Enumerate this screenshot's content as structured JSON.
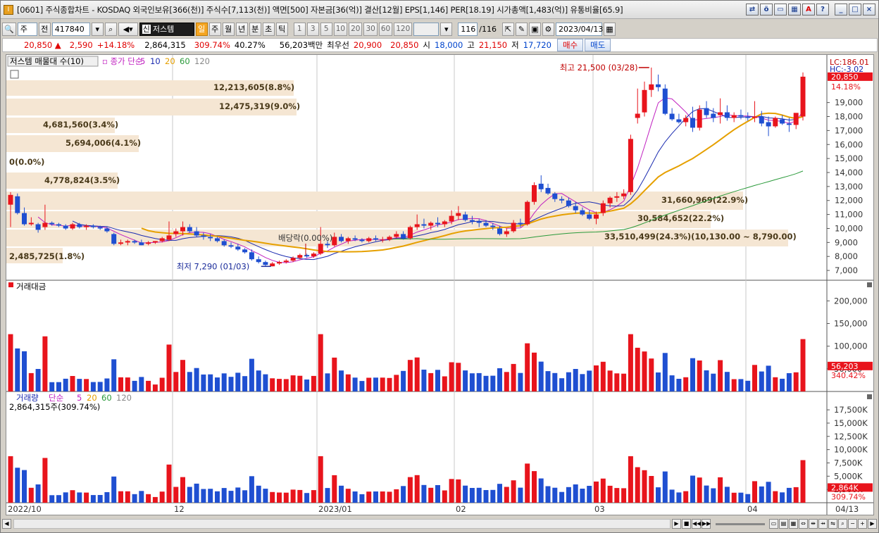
{
  "window": {
    "title": "[0601] 주식종합차트 - KOSDAQ 외국인보유[366(천)] 주식수[7,113(천)] 액면[500] 자본금[36(억)] 결산[12월] EPS[1,146] PER[18.19] 시가총액[1,483(억)] 유통비율[65.9]",
    "icon_label": "I"
  },
  "toolbar": {
    "market": "주",
    "prev_label": "전",
    "code": "417840",
    "stock_name": "저스템",
    "stock_badge": "신",
    "periods": [
      "일",
      "주",
      "월",
      "년",
      "분",
      "초",
      "틱"
    ],
    "active_period": "일",
    "intervals": [
      "1",
      "3",
      "5",
      "10",
      "20",
      "30",
      "60",
      "120"
    ],
    "count": "116",
    "count_total": "/116",
    "date": "2023/04/13"
  },
  "quote": {
    "price": "20,850",
    "arrow": "▲",
    "change": "2,590",
    "change_pct": "+14.18%",
    "volume": "2,864,315",
    "volume_ratio": "309.74%",
    "turnover_ratio": "40.27%",
    "amount": "56,203백만",
    "best_label": "최우선",
    "best_ask": "20,900",
    "best_bid": "20,850",
    "open_label": "시",
    "open": "18,000",
    "high_label": "고",
    "high": "21,150",
    "low_label": "저",
    "low": "17,720",
    "buy_label": "매수",
    "sell_label": "매도"
  },
  "price_panel": {
    "legend_name": "저스템 매물대 수(10)",
    "legend_ma": "종가 단순",
    "ma_periods": [
      "5",
      "10",
      "20",
      "60",
      "120"
    ],
    "ma_colors": {
      "5": "#c020c0",
      "10": "#1a2bb0",
      "20": "#e6a000",
      "60": "#2a9a3a",
      "120": "#888888"
    },
    "lc": "LC:186.01",
    "hc": "HC:-3.02",
    "current_price_tag": "20,850",
    "current_pct_tag": "14.18%",
    "high_note": "최고 21,500 (03/28)",
    "low_note": "최저 7,290 (01/03)",
    "dividend_note": "배당락(0.00%)",
    "volume_profile": [
      {
        "label": "12,213,605(8.8%)"
      },
      {
        "label": "12,475,319(9.0%)"
      },
      {
        "label": "4,681,560(3.4%)"
      },
      {
        "label": "5,694,006(4.1%)"
      },
      {
        "label": "0(0.0%)"
      },
      {
        "label": "4,778,824(3.5%)"
      },
      {
        "label": "31,660,969(22.9%)"
      },
      {
        "label": "30,584,652(22.2%)"
      },
      {
        "label": "33,510,499(24.3%)(10,130.00 ~ 8,790.00)"
      },
      {
        "label": "2,485,725(1.8%)"
      }
    ],
    "y_ticks": [
      "19,000",
      "18,000",
      "17,000",
      "16,000",
      "15,000",
      "14,000",
      "13,000",
      "12,000",
      "11,000",
      "10,000",
      "9,000",
      "8,000",
      "7,000"
    ]
  },
  "amount_panel": {
    "title": "거래대금",
    "y_ticks": [
      "200,000",
      "150,000",
      "100,000",
      "50,000"
    ],
    "tag_value": "56,203",
    "tag_pct": "340.42%"
  },
  "volume_panel": {
    "title": "거래량",
    "legend_ma": "단순",
    "ma_periods": [
      "5",
      "20",
      "60",
      "120"
    ],
    "current_label": "2,864,315주(309.74%)",
    "y_ticks": [
      "17,500K",
      "15,000K",
      "12,500K",
      "10,000K",
      "7,500K",
      "5,000K",
      "2,500K"
    ],
    "tag_value": "2,864K",
    "tag_pct": "309.74%"
  },
  "x_axis": {
    "labels": [
      "2022/10",
      "12",
      "2023/01",
      "02",
      "03",
      "04"
    ],
    "last_label": "04/13"
  },
  "chart_data": {
    "type": "candlestick",
    "ohlc": [
      [
        11700,
        12600,
        10100,
        12400
      ],
      [
        12300,
        12500,
        11000,
        11100
      ],
      [
        11100,
        11500,
        10200,
        10300
      ],
      [
        10300,
        10800,
        10200,
        10400
      ],
      [
        10300,
        10400,
        9700,
        9900
      ],
      [
        10100,
        11700,
        9900,
        10400
      ],
      [
        10400,
        10500,
        10200,
        10300
      ],
      [
        10300,
        10400,
        10100,
        10200
      ],
      [
        10200,
        10300,
        9900,
        10000
      ],
      [
        10000,
        10400,
        9900,
        10300
      ],
      [
        10300,
        10400,
        10000,
        10100
      ],
      [
        10100,
        10300,
        9900,
        10200
      ],
      [
        10200,
        10300,
        10000,
        10100
      ],
      [
        10100,
        10200,
        9900,
        10000
      ],
      [
        10000,
        10100,
        9700,
        9800
      ],
      [
        9600,
        9700,
        8800,
        8900
      ],
      [
        8900,
        9200,
        8800,
        9000
      ],
      [
        9000,
        9200,
        8800,
        9100
      ],
      [
        9100,
        9200,
        8900,
        9000
      ],
      [
        9000,
        9200,
        8800,
        8800
      ],
      [
        8900,
        9100,
        8800,
        9000
      ],
      [
        9000,
        9100,
        8900,
        9100
      ],
      [
        9100,
        9400,
        9000,
        9300
      ],
      [
        9200,
        10500,
        9100,
        9500
      ],
      [
        9600,
        10000,
        9400,
        9800
      ],
      [
        9800,
        10500,
        9500,
        10100
      ],
      [
        10100,
        10300,
        9700,
        9800
      ],
      [
        9800,
        10100,
        9400,
        9500
      ],
      [
        9500,
        9700,
        9200,
        9400
      ],
      [
        9400,
        9600,
        9100,
        9300
      ],
      [
        9300,
        9400,
        9000,
        9100
      ],
      [
        9100,
        9200,
        8700,
        8800
      ],
      [
        8800,
        9000,
        8600,
        8700
      ],
      [
        8700,
        8900,
        8400,
        8500
      ],
      [
        8500,
        8600,
        8200,
        8300
      ],
      [
        8300,
        8500,
        7700,
        7800
      ],
      [
        7800,
        8000,
        7500,
        7600
      ],
      [
        7600,
        7700,
        7300,
        7400
      ],
      [
        7300,
        7600,
        7290,
        7500
      ],
      [
        7500,
        7700,
        7400,
        7600
      ],
      [
        7600,
        7800,
        7500,
        7700
      ],
      [
        7700,
        8000,
        7600,
        7900
      ],
      [
        7900,
        8200,
        7800,
        8100
      ],
      [
        8100,
        8200,
        7900,
        8000
      ],
      [
        8000,
        8300,
        7900,
        8200
      ],
      [
        8200,
        10100,
        8100,
        8900
      ],
      [
        8900,
        9100,
        8600,
        8800
      ],
      [
        8800,
        9700,
        8700,
        9400
      ],
      [
        9400,
        9600,
        9000,
        9100
      ],
      [
        9100,
        9400,
        8900,
        9300
      ],
      [
        9300,
        9500,
        9100,
        9200
      ],
      [
        9200,
        9300,
        9000,
        9100
      ],
      [
        9100,
        9400,
        9000,
        9300
      ],
      [
        9300,
        9500,
        9100,
        9200
      ],
      [
        9200,
        9400,
        9000,
        9200
      ],
      [
        9200,
        9500,
        9100,
        9400
      ],
      [
        9400,
        9800,
        9300,
        9600
      ],
      [
        9600,
        9800,
        9200,
        9300
      ],
      [
        9300,
        10200,
        9200,
        10100
      ],
      [
        10100,
        11000,
        9900,
        10300
      ],
      [
        10300,
        10700,
        10000,
        10200
      ],
      [
        10200,
        10500,
        9900,
        10400
      ],
      [
        10400,
        10800,
        10100,
        10300
      ],
      [
        10300,
        10600,
        10100,
        10500
      ],
      [
        10500,
        11300,
        10300,
        10900
      ],
      [
        10900,
        11600,
        10600,
        11100
      ],
      [
        11000,
        11200,
        10500,
        10600
      ],
      [
        10600,
        10900,
        10300,
        10500
      ],
      [
        10500,
        10700,
        10100,
        10400
      ],
      [
        10400,
        10600,
        10100,
        10200
      ],
      [
        10200,
        10400,
        9900,
        10100
      ],
      [
        10000,
        10200,
        9500,
        9600
      ],
      [
        9600,
        10000,
        9400,
        9800
      ],
      [
        9800,
        10600,
        9700,
        10400
      ],
      [
        10400,
        10700,
        10100,
        10300
      ],
      [
        10300,
        12000,
        10200,
        11900
      ],
      [
        11900,
        13300,
        11700,
        13100
      ],
      [
        13200,
        13800,
        12600,
        12800
      ],
      [
        12900,
        13200,
        12400,
        12500
      ],
      [
        12500,
        12600,
        11900,
        12100
      ],
      [
        12100,
        12300,
        11800,
        12000
      ],
      [
        12000,
        12200,
        11500,
        11600
      ],
      [
        11600,
        11900,
        11100,
        11300
      ],
      [
        11300,
        11500,
        10900,
        11000
      ],
      [
        11000,
        11300,
        10600,
        10700
      ],
      [
        10700,
        11200,
        10300,
        11000
      ],
      [
        11100,
        12000,
        10900,
        11800
      ],
      [
        11800,
        12300,
        11500,
        12200
      ],
      [
        12200,
        12600,
        11900,
        12300
      ],
      [
        12300,
        12800,
        12100,
        12500
      ],
      [
        12600,
        16700,
        12400,
        16400
      ],
      [
        17900,
        20000,
        17500,
        18200
      ],
      [
        18300,
        20500,
        18000,
        19900
      ],
      [
        19900,
        21500,
        19400,
        20300
      ],
      [
        20300,
        21000,
        19800,
        20100
      ],
      [
        20000,
        20300,
        18100,
        18200
      ],
      [
        18200,
        18600,
        17700,
        17800
      ],
      [
        17800,
        18200,
        17500,
        17600
      ],
      [
        17600,
        18100,
        17300,
        17900
      ],
      [
        17900,
        18700,
        16900,
        17200
      ],
      [
        17200,
        18800,
        17000,
        18500
      ],
      [
        18600,
        19100,
        17900,
        18100
      ],
      [
        18200,
        18600,
        17600,
        17900
      ],
      [
        18100,
        19300,
        17500,
        18300
      ],
      [
        18300,
        18800,
        17700,
        17900
      ],
      [
        17900,
        18300,
        17600,
        18100
      ],
      [
        18100,
        18500,
        17800,
        18000
      ],
      [
        18000,
        18300,
        17700,
        17900
      ],
      [
        17900,
        19100,
        17600,
        18000
      ],
      [
        18000,
        18400,
        17300,
        17500
      ],
      [
        17600,
        18000,
        16600,
        17300
      ],
      [
        17300,
        18000,
        17200,
        17900
      ],
      [
        17800,
        18100,
        17400,
        17500
      ],
      [
        17500,
        17900,
        16900,
        17400
      ],
      [
        17400,
        18200,
        17100,
        18260
      ],
      [
        18000,
        21150,
        17720,
        20850
      ]
    ],
    "last_close": 20850,
    "prev_close": 18260,
    "high": 21500,
    "high_date": "03/28",
    "low": 7290,
    "low_date": "01/03",
    "ylim": [
      6300,
      21800
    ],
    "x_labels": [
      "2022/10",
      "12",
      "2023/01",
      "02",
      "03",
      "04"
    ]
  }
}
